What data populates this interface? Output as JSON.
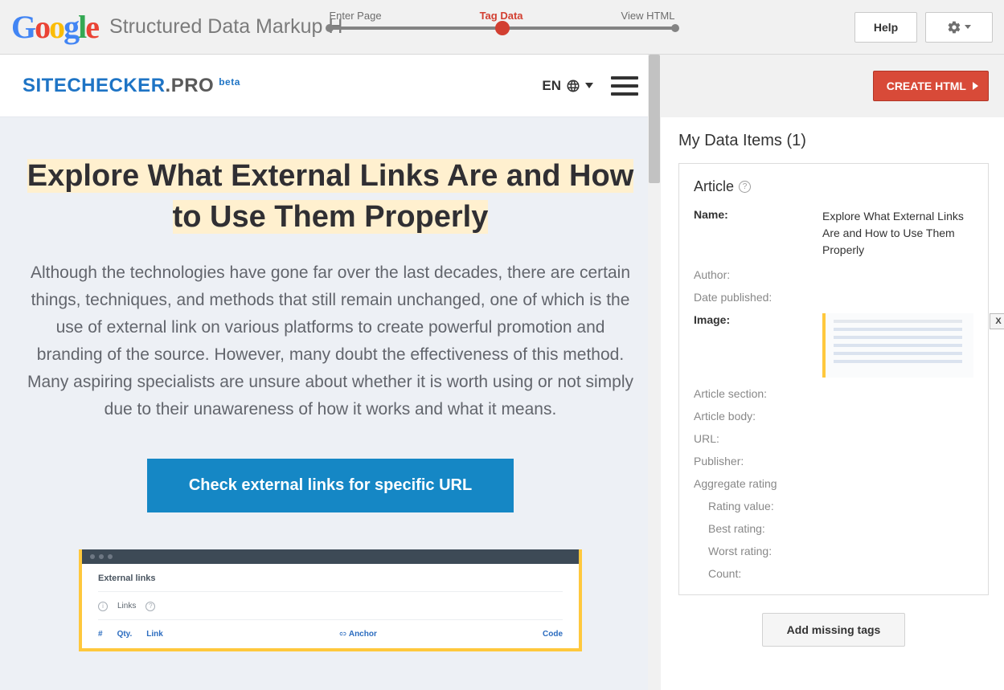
{
  "header": {
    "app_title": "Structured Data Markup Hel",
    "steps": {
      "enter": "Enter Page",
      "tag": "Tag Data",
      "view": "View HTML"
    },
    "help_label": "Help"
  },
  "page": {
    "logo_part1": "SITECHECKER",
    "logo_part2": ".PRO",
    "beta": "beta",
    "lang": "EN",
    "title": "Explore What External Links Are and How to Use Them Properly",
    "description": "Although the technologies have gone far over the last decades, there are certain things, techniques, and methods that still remain unchanged, one of which is the use of external link on various platforms to create powerful promotion and branding of the source. However, many doubt the effectiveness of this method. Many aspiring specialists are unsure about whether it is worth using or not simply due to their unawareness of how it works and what it means.",
    "cta": "Check external links for specific URL",
    "mock": {
      "heading": "External links",
      "links": "Links",
      "hash": "#",
      "qty": "Qty.",
      "link": "Link",
      "anchor": "Anchor",
      "code": "Code"
    }
  },
  "right": {
    "create_label": "CREATE HTML",
    "section_title": "My Data Items (1)",
    "card_title": "Article",
    "fields": {
      "name_label": "Name:",
      "name_value": "Explore What External Links Are and How to Use Them Properly",
      "author": "Author:",
      "date": "Date published:",
      "image": "Image:",
      "section": "Article section:",
      "body": "Article body:",
      "url": "URL:",
      "publisher": "Publisher:",
      "agg": "Aggregate rating",
      "rating_value": "Rating value:",
      "best": "Best rating:",
      "worst": "Worst rating:",
      "count": "Count:",
      "close_x": "X"
    },
    "add_tags": "Add missing tags"
  }
}
